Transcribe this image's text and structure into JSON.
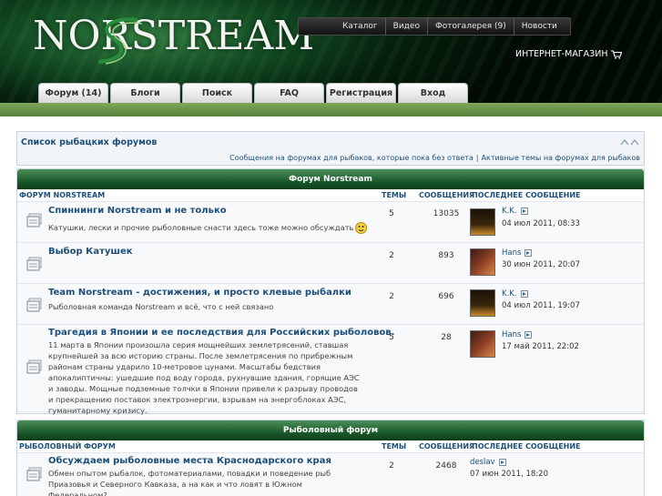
{
  "header": {
    "logo_text": "NORSTREAM",
    "top_links": [
      "Каталог",
      "Видео",
      "Фотогалерея (9)",
      "Новости"
    ],
    "shop_label": "ИНТЕРНЕТ-МАГАЗИН",
    "tabs": [
      "Форум (14)",
      "Блоги",
      "Поиск",
      "FAQ",
      "Регистрация",
      "Вход"
    ]
  },
  "forumlist": {
    "title": "Список рыбацких форумов",
    "link_unanswered": "Сообщения на форумах для рыбаков, которые пока без ответа",
    "link_active": "Активные темы на форумах для рыбаков"
  },
  "sections": [
    {
      "heading": "Форум Norstream",
      "columns": {
        "forum": "ФОРУМ NORSTREAM",
        "topics": "ТЕМЫ",
        "posts": "СООБЩЕНИЯ",
        "last": "ПОСЛЕДНЕЕ СООБЩЕНИЕ"
      },
      "rows": [
        {
          "title": "Спиннинги Norstream и не только",
          "desc": "Катушки, лески и прочие рыболовные снасти здесь тоже можно обсуждать",
          "topics": "5",
          "posts": "13035",
          "author": "K.K.",
          "date": "04 июл 2011, 08:33"
        },
        {
          "title": "Выбор Катушек",
          "desc": "",
          "topics": "2",
          "posts": "893",
          "author": "Hans",
          "date": "30 июн 2011, 20:07"
        },
        {
          "title": "Team Norstream - достижения, и просто клевые рыбалки",
          "desc": "Рыболовная команда Norstream и всё, что с ней связано",
          "topics": "2",
          "posts": "696",
          "author": "K.K.",
          "date": "04 июл 2011, 19:07"
        },
        {
          "title": "Трагедия в Японии и ее последствия для Российских рыболовов.",
          "desc": "11 марта в Японии произошла серия мощнейших землетрясений, ставшая крупнейшей за всю историю страны. После землетрясения по прибрежным районам страны ударило 10-метровое цунами. Масштабы бедствия апокалиптичны: ушедшие под воду города, рухнувшие здания, горящие АЭС и заводы. Мощные подземные толчки в Японии привели к разрыву проводов и прекращению поставок электроэнергии, взрывам на энергоблоках АЭС, гуманитарному кризису.",
          "topics": "5",
          "posts": "28",
          "author": "Hans",
          "date": "17 май 2011, 22:02"
        }
      ]
    },
    {
      "heading": "Рыболовный форум",
      "columns": {
        "forum": "РЫБОЛОВНЫЙ ФОРУМ",
        "topics": "ТЕМЫ",
        "posts": "СООБЩЕНИЯ",
        "last": "ПОСЛЕДНЕЕ СООБЩЕНИЕ"
      },
      "rows": [
        {
          "title": "Обсуждаем рыболовные места Краснодарского края",
          "desc": "Обмен опытом рыбалок, фотоматериалами, повадки и поведение рыб Приазовья и Северного Кавказа, а на как и что ловят в Южном Федеральном?..",
          "topics": "2",
          "posts": "2468",
          "author": "deslav",
          "date": "07 июн 2011, 18:20"
        }
      ]
    }
  ],
  "colors": {
    "accent_blue": "#1e4f7a",
    "header_green": "#1b5a2b",
    "bar_green": "#6b9448"
  }
}
